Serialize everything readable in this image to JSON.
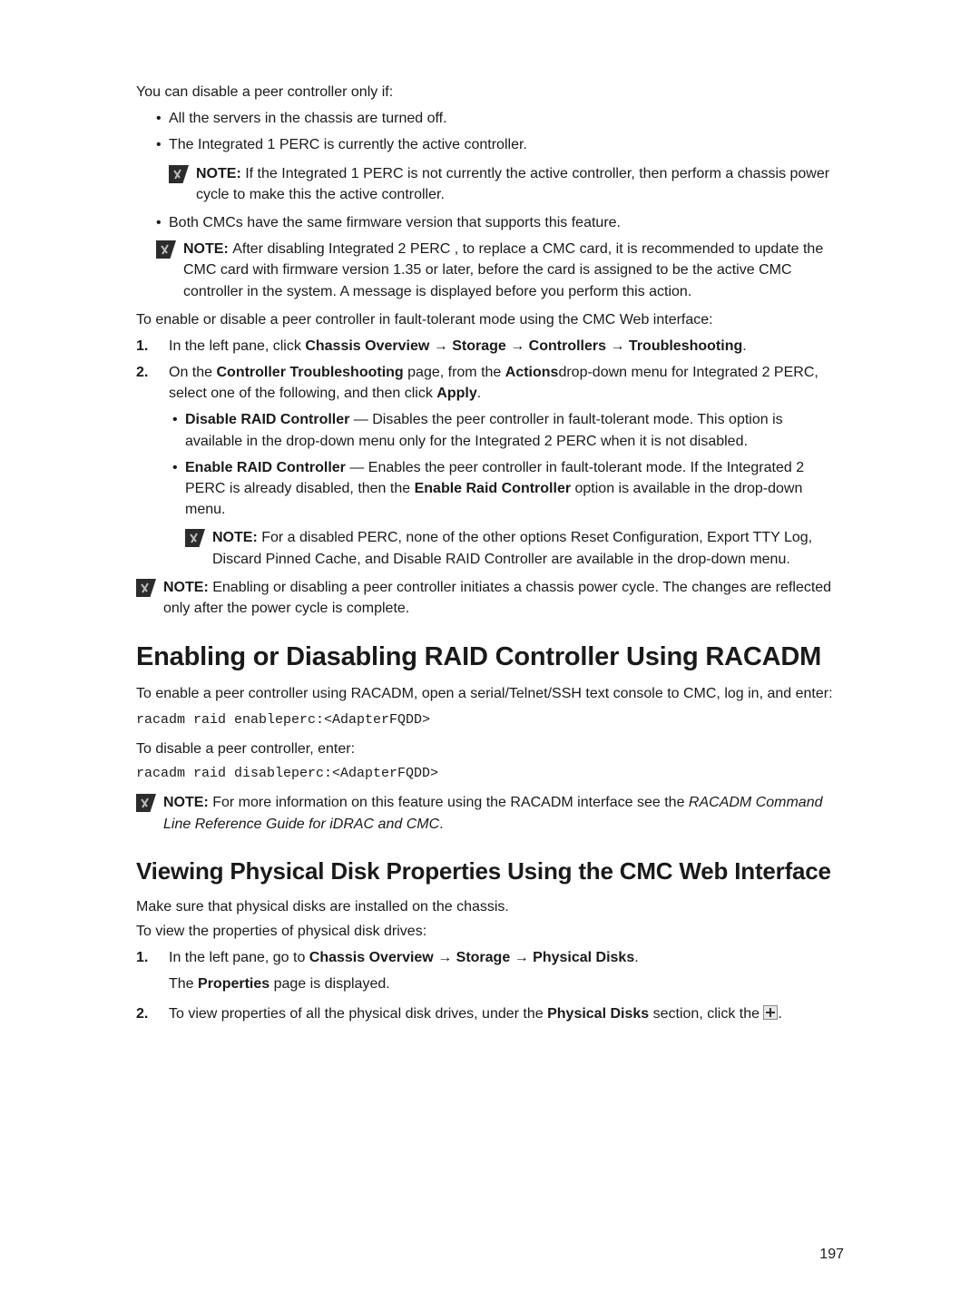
{
  "intro": {
    "opening": "You can disable a peer controller only if:",
    "req1": "All the servers in the chassis are turned off.",
    "req2": "The Integrated 1 PERC is currently the active controller.",
    "note_req2_label": "NOTE: ",
    "note_req2_text": "If the Integrated 1 PERC is not currently the active controller, then perform a chassis power cycle to make this the active controller.",
    "req3": "Both CMCs have the same firmware version that supports this feature.",
    "note_top_label": "NOTE: ",
    "note_top_text": "After disabling Integrated 2 PERC , to replace a CMC card, it is recommended to update the CMC card with firmware version 1.35 or later, before the card is assigned to be the active CMC controller in the system. A message is displayed before you perform this action.",
    "enable_disable_intro": "To enable or disable a peer controller in fault-tolerant mode using the CMC Web interface:"
  },
  "steps_web": {
    "s1_prefix": "In the left pane, click ",
    "s1_path_a": "Chassis Overview",
    "s1_arrow": "→",
    "s1_path_b": "Storage",
    "s1_path_c": "Controllers",
    "s1_path_d": "Troubleshooting",
    "s1_period": ".",
    "s2_a": "On the ",
    "s2_b": "Controller Troubleshooting",
    "s2_c": " page, from the ",
    "s2_d": "Actions",
    "s2_e": "drop-down menu for Integrated 2 PERC, select one of the following, and then click ",
    "s2_f": "Apply",
    "s2_g": ".",
    "opt1_label": "Disable RAID Controller",
    "opt1_text": " — Disables the peer controller in fault-tolerant mode. This option is available in the drop-down menu only for the Integrated 2 PERC when it is not disabled.",
    "opt2_label": "Enable RAID Controller",
    "opt2_text_a": " — Enables the peer controller in fault-tolerant mode. If the Integrated 2 PERC is already disabled, then the ",
    "opt2_inline_bold": "Enable Raid Controller",
    "opt2_text_b": " option is available in the drop-down menu.",
    "opt2_note_label": "NOTE: ",
    "opt2_note_text": "For a disabled PERC, none of the other options Reset Configuration, Export TTY Log, Discard Pinned Cache, and Disable RAID Controller are available in the drop-down menu.",
    "closing_note_label": "NOTE: ",
    "closing_note_text": "Enabling or disabling a peer controller initiates a chassis power cycle. The changes are reflected only after the power cycle is complete."
  },
  "section1": {
    "heading": "Enabling or Diasabling RAID Controller Using RACADM",
    "intro": "To enable a peer controller using RACADM, open a serial/Telnet/SSH text console to CMC, log in, and enter:",
    "cmd1": "racadm raid enableperc:<AdapterFQDD>",
    "disable_intro": "To disable a peer controller, enter:",
    "cmd2": "racadm raid disableperc:<AdapterFQDD>",
    "note_label": "NOTE: ",
    "note_a": "For more information on this feature using the RACADM interface see the ",
    "note_i": "RACADM Command Line Reference Guide for iDRAC and CMC",
    "note_b": "."
  },
  "section2": {
    "heading": "Viewing Physical Disk Properties Using the CMC Web Interface",
    "p1": "Make sure that physical disks are installed on the chassis.",
    "p2": "To view the properties of physical disk drives:",
    "s1_a": "In the left pane, go to ",
    "s1_b": "Chassis Overview",
    "s1_arrow": "→",
    "s1_c": "Storage",
    "s1_d": "Physical Disks",
    "s1_e": ".",
    "s1_line2a": "The ",
    "s1_line2b": "Properties",
    "s1_line2c": " page is displayed.",
    "s2_a": "To view properties of all the physical disk drives, under the ",
    "s2_b": "Physical Disks",
    "s2_c": " section, click the ",
    "s2_d": "."
  },
  "page_number": "197"
}
